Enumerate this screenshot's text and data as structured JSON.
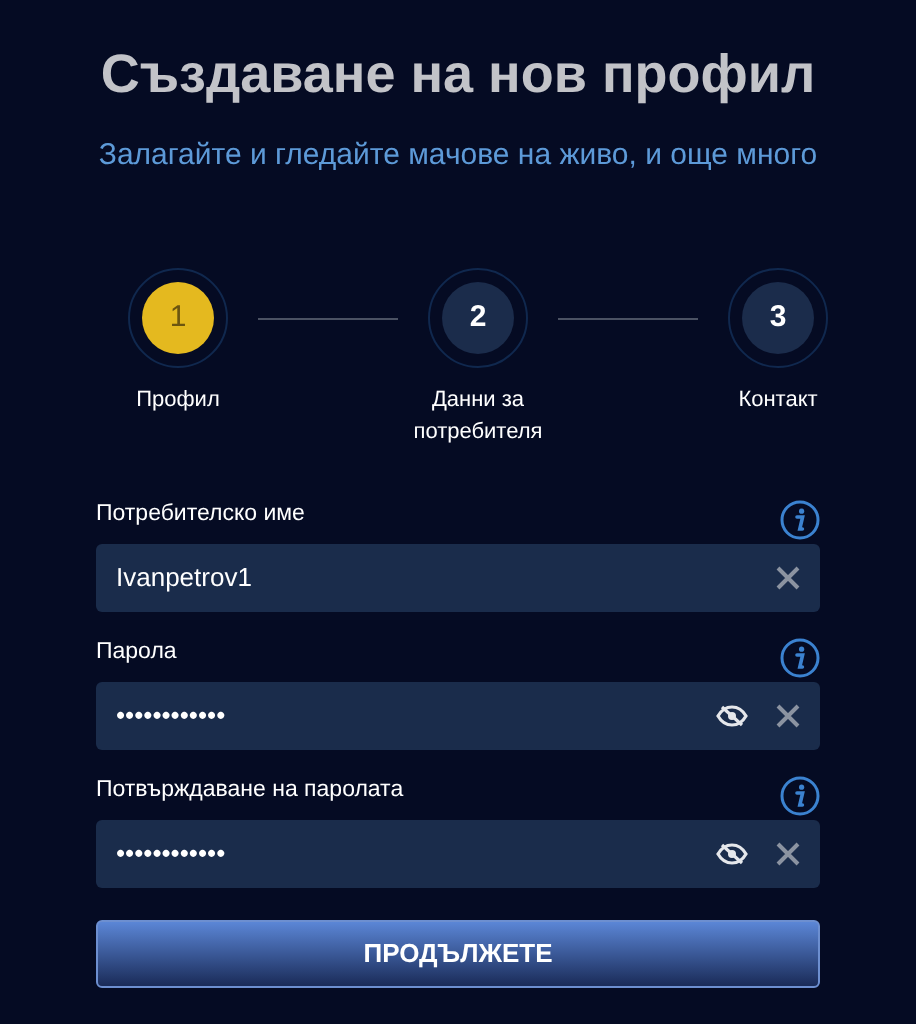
{
  "title": "Създаване на нов профил",
  "subtitle": "Залагайте и гледайте мачове на живо, и още много",
  "steps": [
    {
      "number": "1",
      "label": "Профил",
      "selected": true
    },
    {
      "number": "2",
      "label": "Данни за потребителя",
      "selected": false
    },
    {
      "number": "3",
      "label": "Контакт",
      "selected": false
    }
  ],
  "fields": [
    {
      "kind": "text",
      "label": "Потребителско име",
      "value": "Ivanpetrov1"
    },
    {
      "kind": "password",
      "label": "Парола",
      "value": "••••••••••••"
    },
    {
      "kind": "password",
      "label": "Потвърждаване на паролата",
      "value": "••••••••••••"
    }
  ],
  "button": "ПРОДЪЛЖЕТЕ"
}
